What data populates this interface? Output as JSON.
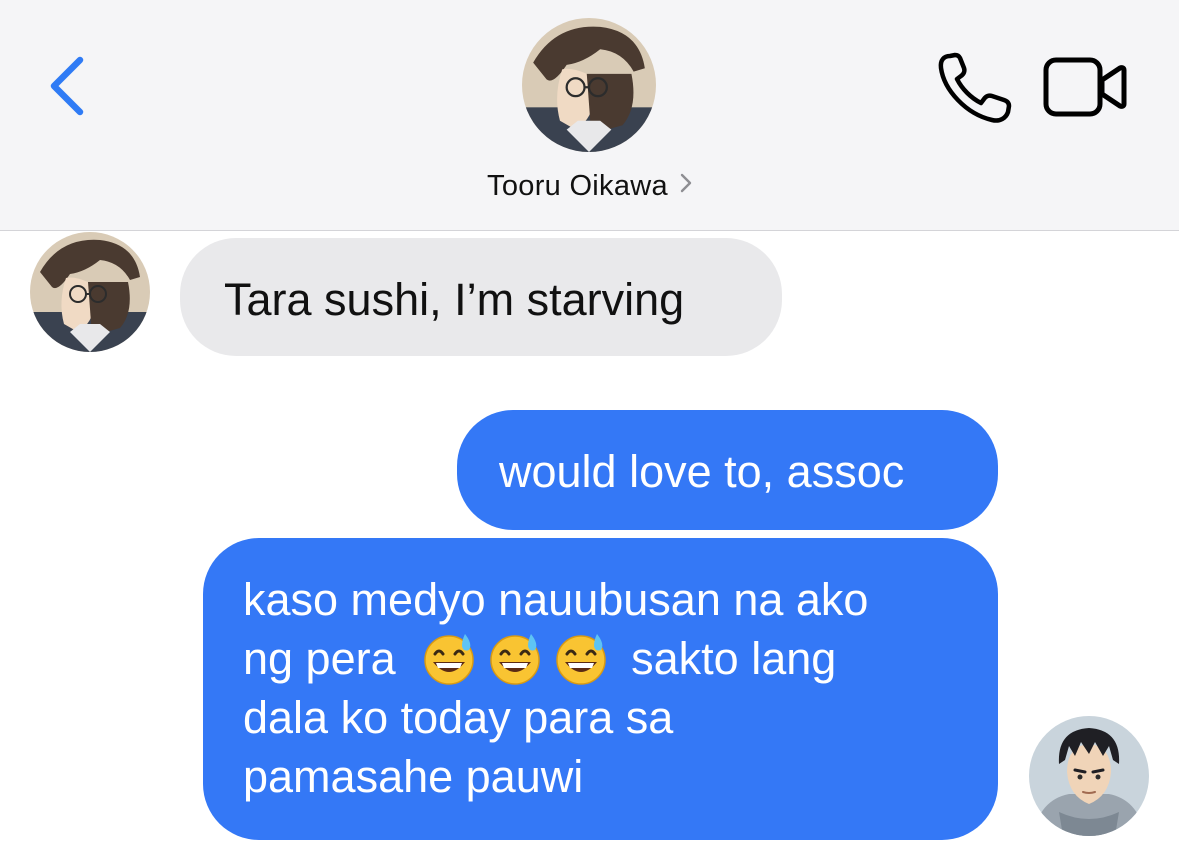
{
  "header": {
    "contact_name": "Tooru Oikawa",
    "back_icon": "chevron-left-icon",
    "call_icon": "phone-icon",
    "video_icon": "video-camera-icon",
    "detail_icon": "chevron-right-icon"
  },
  "messages": [
    {
      "direction": "incoming",
      "text": "Tara sushi, I’m starving"
    },
    {
      "direction": "outgoing",
      "text": "would love to, assoc"
    },
    {
      "direction": "outgoing",
      "line1": "kaso medyo nauubusan na ako",
      "line2_prefix": "ng pera",
      "emoji": "grinning-face-with-sweat-emoji",
      "emoji_count": 3,
      "line2_suffix": "sakto lang",
      "line3": "dala ko today para sa",
      "line4": "pamasahe pauwi"
    }
  ],
  "colors": {
    "accent_blue": "#3478f6",
    "incoming_bubble": "#e9e9eb",
    "header_background": "#f5f5f7",
    "back_chevron": "#2f7bf5"
  }
}
